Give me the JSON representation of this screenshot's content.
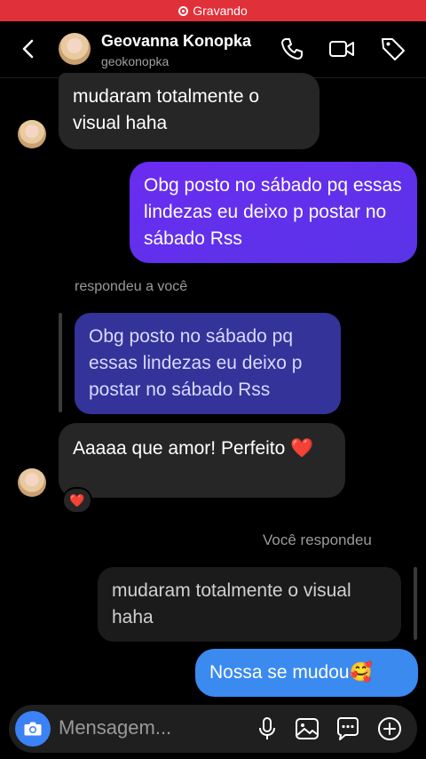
{
  "recording": {
    "label": "Gravando"
  },
  "header": {
    "name": "Geovanna Konopka",
    "handle": "geokonopka"
  },
  "messages": {
    "m1": "mudaram totalmente o visual haha",
    "m2": "Obg posto no sábado pq essas lindezas eu deixo p postar no sábado Rss",
    "reply_label": "respondeu a você",
    "m3_quote": "Obg posto no sábado pq essas lindezas eu deixo p postar no sábado Rss",
    "m4": "Aaaaa que amor! Perfeito ❤️",
    "reaction": "❤️",
    "you_replied": "Você respondeu",
    "m5_quote": "mudaram totalmente o visual haha",
    "m6": "Nossa se mudou🥰"
  },
  "composer": {
    "placeholder": "Mensagem..."
  }
}
